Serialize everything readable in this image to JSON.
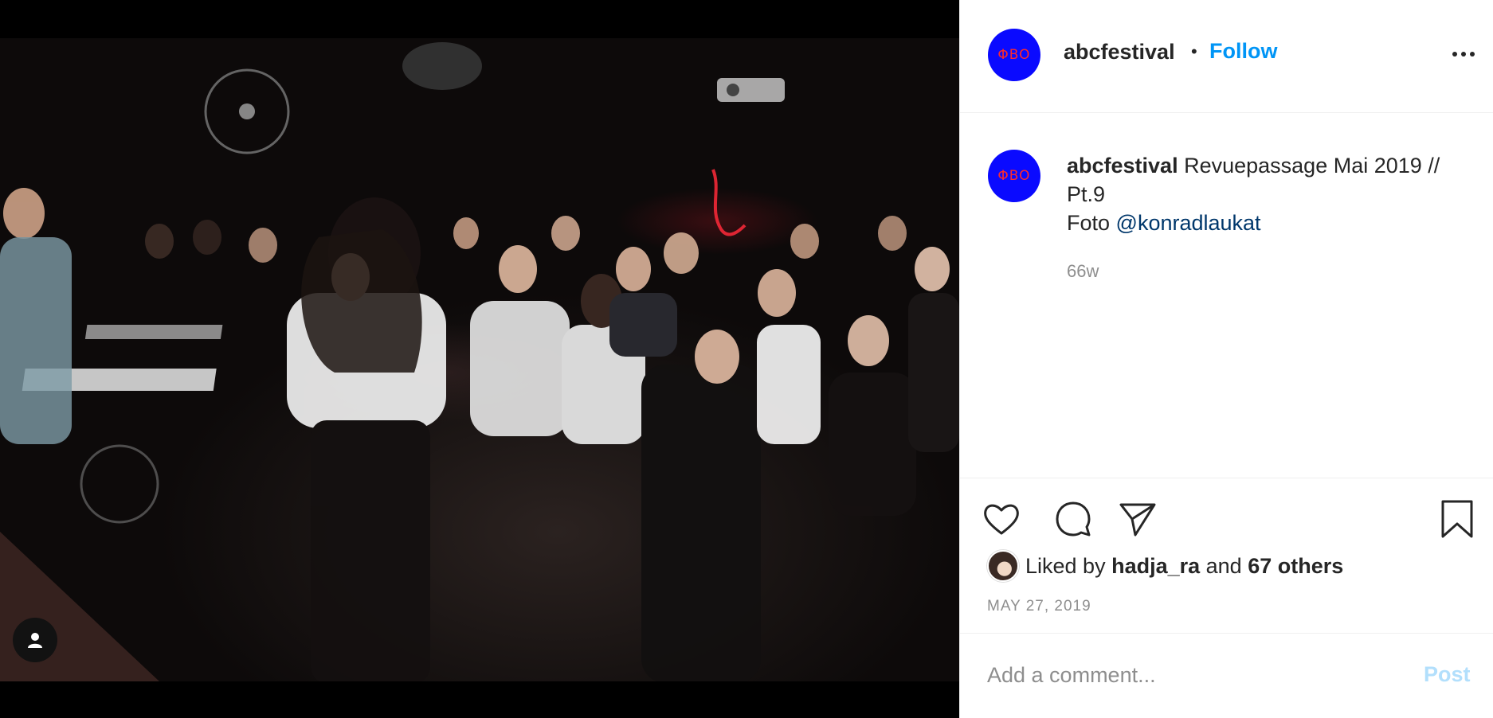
{
  "post": {
    "media": {
      "description_icon": "user-tag-icon"
    },
    "header": {
      "avatar_logo": "ΦBO",
      "username": "abcfestival",
      "separator": "•",
      "follow_label": "Follow",
      "more_icon": "more-horizontal-icon"
    },
    "caption": {
      "avatar_logo": "ΦBO",
      "username": "abcfestival",
      "text": " Revuepassage Mai 2019 // Pt.9",
      "foto_prefix": "Foto ",
      "mention": "@konradlaukat",
      "time_ago": "66w"
    },
    "actions": {
      "icons": [
        "heart-icon",
        "comment-icon",
        "share-icon",
        "bookmark-icon"
      ]
    },
    "likes": {
      "prefix": "Liked by ",
      "liker": "hadja_ra",
      "joiner": " and ",
      "others": "67 others"
    },
    "date": "MAY 27, 2019",
    "comment": {
      "placeholder": "Add a comment...",
      "post_label": "Post"
    }
  },
  "colors": {
    "brand_avatar_bg": "#0a0aff",
    "brand_avatar_logo": "#ff2a2a",
    "follow_blue": "#0095f6",
    "mention_blue": "#00376b",
    "post_disabled": "#b2dffc",
    "muted_text": "#8e8e8e"
  }
}
